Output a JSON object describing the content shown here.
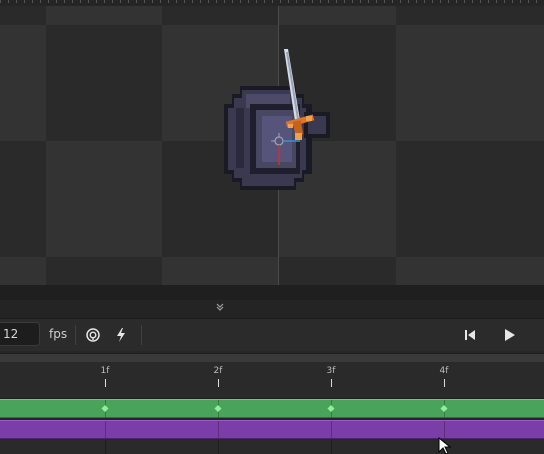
{
  "viewport": {
    "tiles": "checkerboard",
    "sprite": "knight-with-sword"
  },
  "panel": {
    "collapse_icon": "double-chevron-down-icon",
    "fps_value": "12",
    "fps_label": "fps",
    "tools": [
      "onion-skin-icon",
      "lightning-icon"
    ],
    "playback": [
      "skip-to-start-icon",
      "play-icon"
    ]
  },
  "timeline": {
    "frames": [
      "1f",
      "2f",
      "3f",
      "4f"
    ],
    "tracks": [
      {
        "color": "#4aa35a",
        "keyframes": 4
      },
      {
        "color": "#7b3ea8",
        "keyframes": 0
      }
    ]
  }
}
